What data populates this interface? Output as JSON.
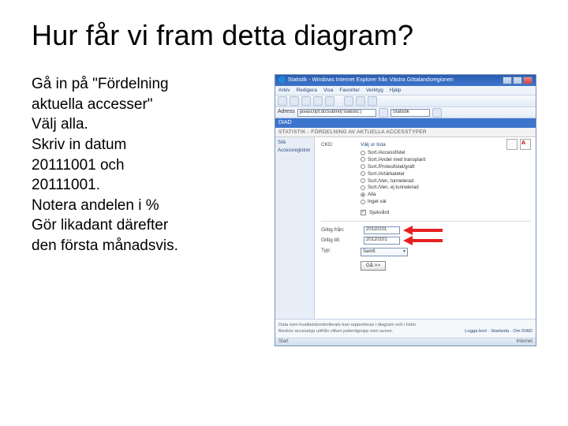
{
  "title": "Hur får vi fram detta diagram?",
  "instructions": {
    "line1": "Gå in på \"Fördelning",
    "line2": "aktuella accesser\"",
    "line3": "Välj alla.",
    "line4": "Skriv in datum",
    "line5": "20111001 och",
    "line6": "20111001.",
    "line7": "Notera andelen i %",
    "line8": "Gör likadant därefter",
    "line9": "den första månadsvis."
  },
  "window": {
    "title": "Statistik - Windows Internet Explorer från Västra Götalandsregionen",
    "menubar": [
      "Arkiv",
      "Redigera",
      "Visa",
      "Favoriter",
      "Verktyg",
      "Hjälp"
    ],
    "address_label": "Adress",
    "address": "javascript:doSubmit('statistic')",
    "address2": "Statistik",
    "blue_header": "DIAD",
    "section_title": "STATISTIK - FÖRDELNING AV AKTUELLA ACCESSTYPER",
    "leftnav": [
      "Sök",
      "Accessregistret"
    ],
    "field_ckd": "CKD:",
    "ckd_value": "Välj ur lista",
    "options": [
      "Sort./Accessfistel",
      "Sort./Andel med transplant",
      "Sort./Protesfistel/graft",
      "Sort./Artärkateter",
      "Sort./Ven, tunnelerad",
      "Sort./Ven, ej tunnelerad",
      "Alla",
      "Inget val"
    ],
    "checked_option_index": 6,
    "checkbox_label": "Sjukvård",
    "date_from_label": "Giltig från:",
    "date_to_label": "Giltig till:",
    "date_from": "20110101",
    "date_to": "20120101",
    "type_label": "Typ:",
    "type_value": "Samtl.",
    "go_button": "Gå >>",
    "status_line1": "Data som kvalitetskontrollerats kan rapporteras i diagram och i listor.",
    "status_line2": "Beskriv accesstyp utifrån vilken patientgrupp som avses.",
    "status_links": "Logga bort · Startsida · Om DIAD",
    "bottom_left": "Start",
    "bottom_right": "Internet"
  }
}
